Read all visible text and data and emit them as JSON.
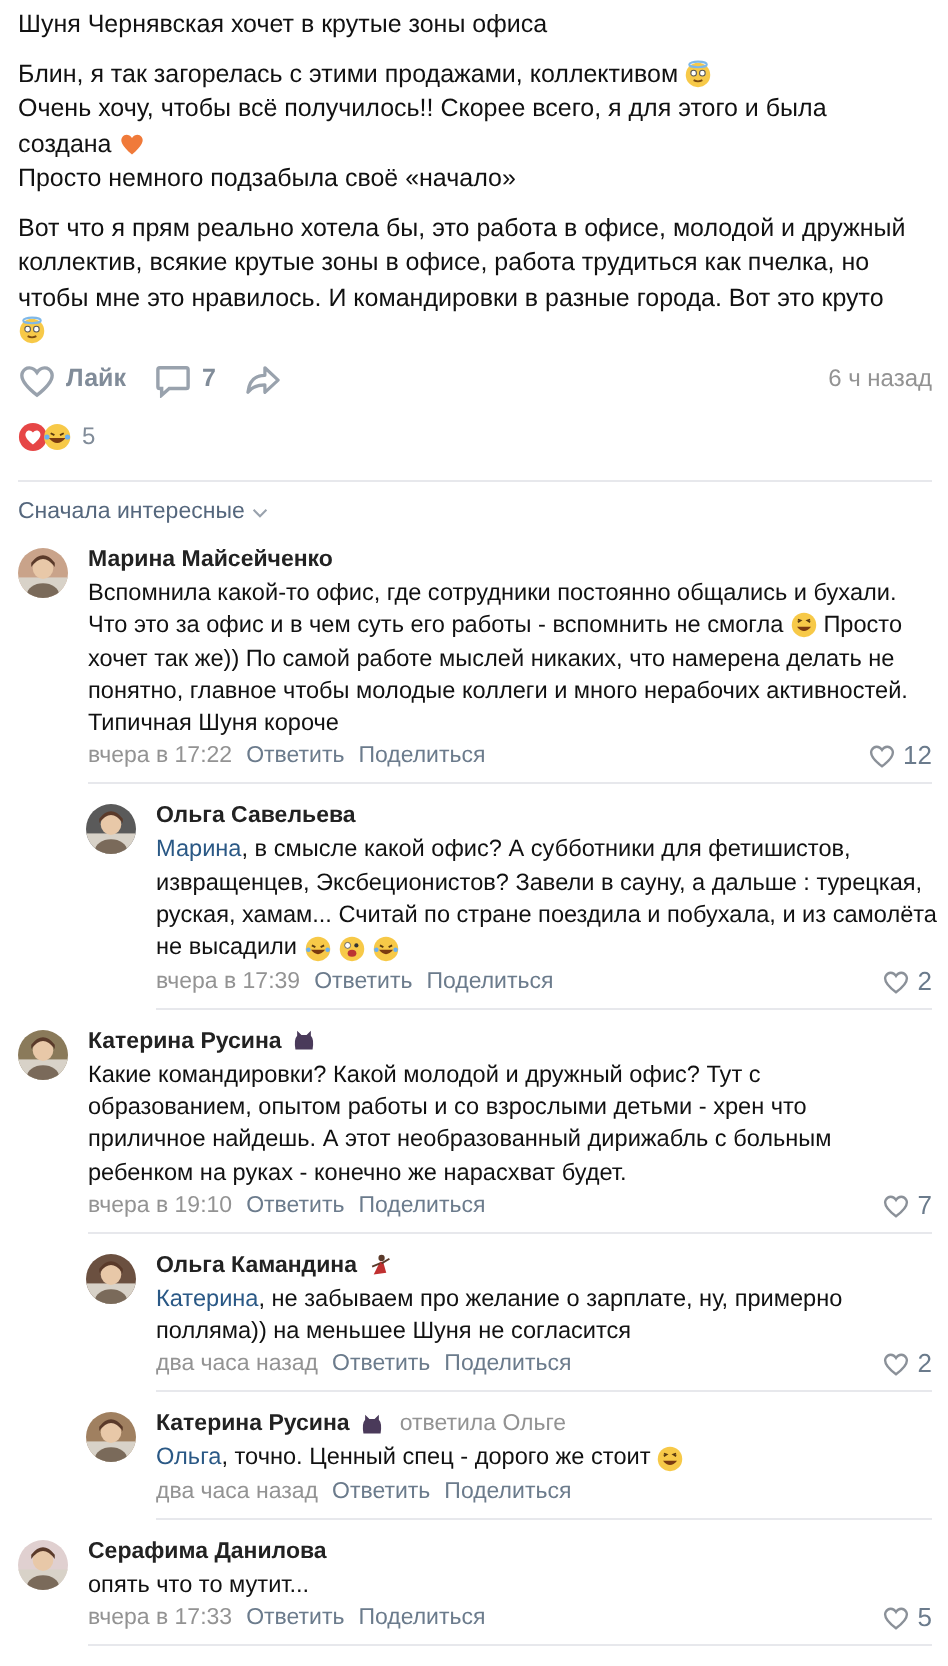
{
  "post": {
    "title": "Шуня Чернявская хочет в крутые зоны офиса",
    "blocks": [
      [
        [
          {
            "kind": "text",
            "text": "Блин, я так загорелась с этими продажами, коллективом"
          },
          {
            "kind": "halo"
          }
        ],
        [
          {
            "kind": "text",
            "text": "Очень хочу, чтобы всё получилось!! Скорее всего, я для этого и была"
          }
        ],
        [
          {
            "kind": "text",
            "text": "создана"
          },
          {
            "kind": "heart"
          }
        ],
        [
          {
            "kind": "text",
            "text": "Просто немного подзабыла своё «начало»"
          }
        ]
      ],
      [
        [
          {
            "kind": "text",
            "text": "Вот что я прям реально хотела бы, это работа в офисе, молодой и дружный"
          }
        ],
        [
          {
            "kind": "text",
            "text": "коллектив, всякие крутые зоны в офисе, работа трудиться как пчелка, но"
          }
        ],
        [
          {
            "kind": "text",
            "text": "чтобы мне это нравилось. И командировки в разные города. Вот это круто"
          }
        ],
        [
          {
            "kind": "halo"
          }
        ]
      ]
    ],
    "like_label": "Лайк",
    "comments_count": "7",
    "time": "6 ч назад",
    "reactions": {
      "count": "5"
    }
  },
  "sort": {
    "label": "Сначала интересные"
  },
  "comments": [
    {
      "author": "Марина Майсейченко",
      "lines": [
        [
          {
            "kind": "text",
            "text": "Вспомнила какой-то офис, где сотрудники постоянно общались и бухали."
          }
        ],
        [
          {
            "kind": "text",
            "text": "Что это за офис и в чем суть его работы - вспомнить не смогла"
          },
          {
            "kind": "grin"
          },
          {
            "kind": "text",
            "text": "Просто"
          }
        ],
        [
          {
            "kind": "text",
            "text": "хочет так же)) По самой работе мыслей никаких, что намерена делать не"
          }
        ],
        [
          {
            "kind": "text",
            "text": "понятно, главное чтобы молодые коллеги и много нерабочих активностей."
          }
        ],
        [
          {
            "kind": "text",
            "text": "Типичная Шуня короче"
          }
        ]
      ],
      "time": "вчера в 17:22",
      "reply": "Ответить",
      "share": "Поделиться",
      "likes": "12",
      "children": [
        {
          "author": "Ольга Савельева",
          "lines": [
            [
              {
                "kind": "mention",
                "text": "Марина"
              },
              {
                "kind": "text",
                "text": ", в смысле какой офис? А субботники для фетишистов,"
              }
            ],
            [
              {
                "kind": "text",
                "text": "извращенцев, Эксбеционистов? Завели в сауну, а дальше : турецкая,"
              }
            ],
            [
              {
                "kind": "text",
                "text": "руская, хамам... Считай по стране поездила и побухала, и из самолёта"
              }
            ],
            [
              {
                "kind": "text",
                "text": "не высадили"
              },
              {
                "kind": "rofl"
              },
              {
                "kind": "wink"
              },
              {
                "kind": "rofl"
              }
            ]
          ],
          "time": "вчера в 17:39",
          "reply": "Ответить",
          "share": "Поделиться",
          "likes": "2"
        }
      ]
    },
    {
      "author": "Катерина Русина",
      "badge": {
        "kind": "cat"
      },
      "lines": [
        [
          {
            "kind": "text",
            "text": "Какие командировки? Какой молодой и дружный офис? Тут с"
          }
        ],
        [
          {
            "kind": "text",
            "text": "образованием, опытом работы и со взрослыми детьми - хрен что"
          }
        ],
        [
          {
            "kind": "text",
            "text": "приличное найдешь. А этот необразованный дирижабль с больным"
          }
        ],
        [
          {
            "kind": "text",
            "text": "ребенком на руках - конечно же нарасхват будет."
          }
        ]
      ],
      "time": "вчера в 19:10",
      "reply": "Ответить",
      "share": "Поделиться",
      "likes": "7",
      "children": [
        {
          "author": "Ольга Камандина",
          "badge": {
            "kind": "dancer"
          },
          "lines": [
            [
              {
                "kind": "mention",
                "text": "Катерина"
              },
              {
                "kind": "text",
                "text": ", не забываем про желание о зарплате, ну, примерно"
              }
            ],
            [
              {
                "kind": "text",
                "text": "поллямa)) на меньшее Шуня не согласится"
              }
            ]
          ],
          "time": "два часа назад",
          "reply": "Ответить",
          "share": "Поделиться",
          "likes": "2"
        },
        {
          "author": "Катерина Русина",
          "badge": {
            "kind": "cat"
          },
          "replied_to": "ответила Ольге",
          "lines": [
            [
              {
                "kind": "mention",
                "text": "Ольга"
              },
              {
                "kind": "text",
                "text": ", точно. Ценный спец - дорого же стоит"
              },
              {
                "kind": "grin"
              }
            ]
          ],
          "time": "два часа назад",
          "reply": "Ответить",
          "share": "Поделиться"
        }
      ]
    },
    {
      "author": "Серафима Данилова",
      "lines": [
        [
          {
            "kind": "text",
            "text": "опять что то мутит..."
          }
        ]
      ],
      "time": "вчера в 17:33",
      "reply": "Ответить",
      "share": "Поделиться",
      "likes": "5"
    }
  ]
}
